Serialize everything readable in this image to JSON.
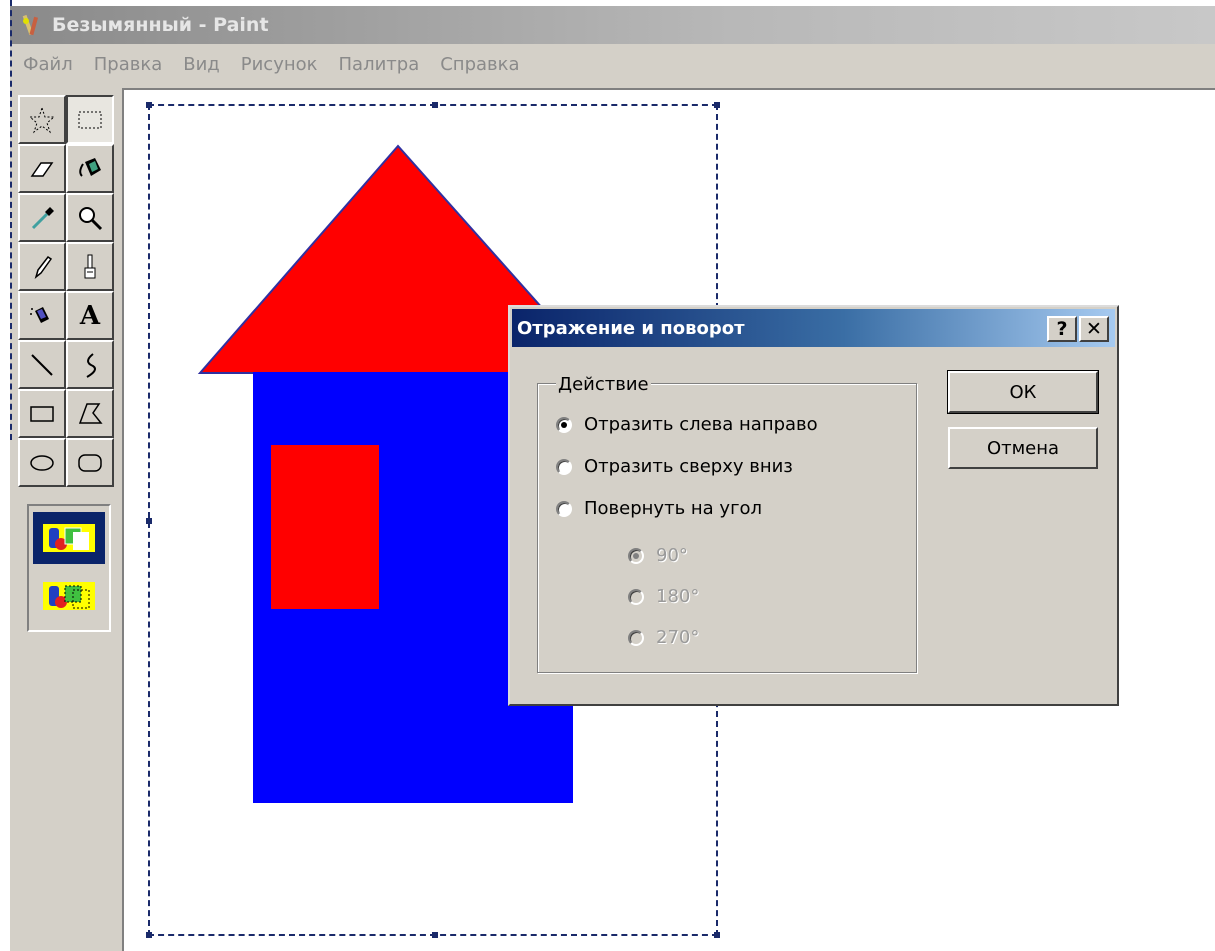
{
  "window": {
    "title": "Безымянный - Paint",
    "app_icon": "paint-icon"
  },
  "menu": {
    "items": [
      "Файл",
      "Правка",
      "Вид",
      "Рисунок",
      "Палитра",
      "Справка"
    ]
  },
  "toolbox": {
    "tools": [
      {
        "name": "free-form-select-tool",
        "icon": "star-select-icon"
      },
      {
        "name": "rect-select-tool",
        "icon": "dashed-rect-icon",
        "pressed": true
      },
      {
        "name": "eraser-tool",
        "icon": "eraser-icon"
      },
      {
        "name": "fill-tool",
        "icon": "paint-bucket-icon"
      },
      {
        "name": "pick-color-tool",
        "icon": "eyedropper-icon"
      },
      {
        "name": "magnifier-tool",
        "icon": "magnifier-icon"
      },
      {
        "name": "pencil-tool",
        "icon": "pencil-icon"
      },
      {
        "name": "brush-tool",
        "icon": "brush-icon"
      },
      {
        "name": "airbrush-tool",
        "icon": "airbrush-icon"
      },
      {
        "name": "text-tool",
        "icon": "text-a-icon",
        "label": "A"
      },
      {
        "name": "line-tool",
        "icon": "line-icon"
      },
      {
        "name": "curve-tool",
        "icon": "curve-icon"
      },
      {
        "name": "rectangle-tool",
        "icon": "rectangle-icon"
      },
      {
        "name": "polygon-tool",
        "icon": "polygon-icon"
      },
      {
        "name": "ellipse-tool",
        "icon": "ellipse-icon"
      },
      {
        "name": "rounded-rect-tool",
        "icon": "rounded-rect-icon"
      }
    ],
    "options": [
      "opaque-selection-icon",
      "transparent-selection-icon"
    ],
    "selected_option": 0
  },
  "drawing": {
    "roof_color": "#ff0000",
    "wall_color": "#0000ff",
    "window_color": "#ff0000"
  },
  "dialog": {
    "title": "Отражение и поворот",
    "help_label": "?",
    "close_label": "✕",
    "group_label": "Действие",
    "options": [
      {
        "label": "Отразить слева направо",
        "checked": true
      },
      {
        "label": "Отразить сверху вниз",
        "checked": false
      },
      {
        "label": "Повернуть на угол",
        "checked": false
      }
    ],
    "angles": [
      {
        "label": "90°",
        "checked": true
      },
      {
        "label": "180°",
        "checked": false
      },
      {
        "label": "270°",
        "checked": false
      }
    ],
    "ok_label": "ОК",
    "cancel_label": "Отмена",
    "title_gradient_start": "#0a246a"
  }
}
